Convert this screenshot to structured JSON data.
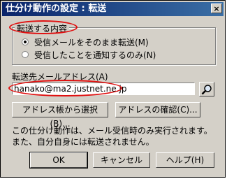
{
  "window": {
    "title": "仕分け動作の設定 : 転送",
    "close_glyph": "×"
  },
  "content_group": {
    "legend": "転送する内容",
    "options": [
      {
        "label": "受信メールをそのまま転送(M)",
        "checked": true
      },
      {
        "label": "受信したことを通知するのみ(N)",
        "checked": false
      }
    ]
  },
  "address": {
    "label": "転送先メールアドレス(A)",
    "value": "hanako@ma2.justnet.ne.jp"
  },
  "buttons": {
    "address_book": "アドレス帳から選択(B)...",
    "confirm_address": "アドレスの確認(C)...",
    "ok": "OK",
    "cancel": "キャンセル",
    "help": "ヘルプ(H)"
  },
  "note": {
    "line1": "この仕分け動作は、メール受信時のみ実行されます。",
    "line2": "また、自分自身には転送されません。"
  },
  "accent": {
    "title_bar": "#0a246a",
    "highlight": "#e01010"
  }
}
